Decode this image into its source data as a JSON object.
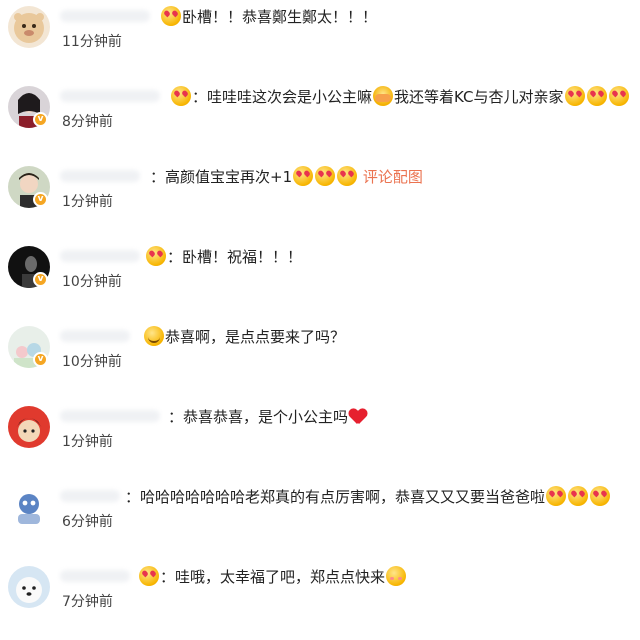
{
  "comments": [
    {
      "text": "卧槽！！恭喜鄭生鄭太！！！",
      "time": "11分钟前"
    },
    {
      "text_a": "哇哇哇这次会是小公主嘛",
      "text_b": "我还等着KC与杏儿对亲家",
      "time": "8分钟前"
    },
    {
      "text": "：高颜值宝宝再次+1",
      "link": "评论配图",
      "time": "1分钟前"
    },
    {
      "text": "卧槽！祝福！！！",
      "time": "10分钟前"
    },
    {
      "text": "恭喜啊，是点点要来了吗？",
      "time": "10分钟前"
    },
    {
      "text": "：恭喜恭喜，是个小公主吗",
      "time": "1分钟前"
    },
    {
      "text": "：哈哈哈哈哈哈哈老郑真的有点厉害啊，恭喜又又又要当爸爸啦",
      "time": "6分钟前"
    },
    {
      "text": "哇哦，太幸福了吧，郑点点快来",
      "time": "7分钟前"
    }
  ],
  "icons": {
    "verified": "verified-badge-icon",
    "love_emoji": "heart-eyes-emoji-icon",
    "heart": "red-heart-icon",
    "smile": "smile-emoji-icon",
    "cover": "cover-face-emoji-icon",
    "shy": "shy-emoji-icon"
  },
  "colors": {
    "link": "#eb7350",
    "badge": "#f5a623",
    "time": "#444444"
  }
}
